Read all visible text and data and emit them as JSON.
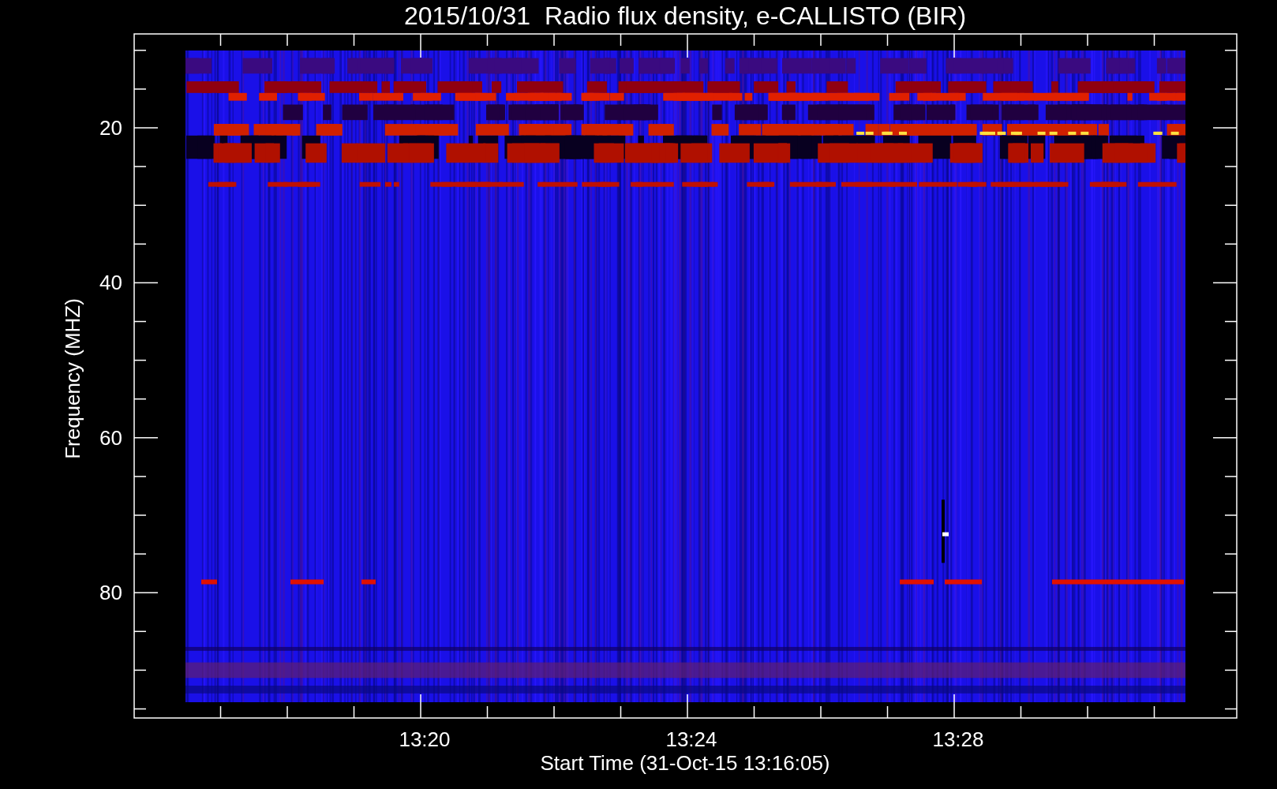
{
  "title": "2015/10/31  Radio flux density, e-CALLISTO (BIR)",
  "y_axis": {
    "label": "Frequency (MHZ)",
    "ticks": [
      "20",
      "40",
      "60",
      "80"
    ]
  },
  "x_axis": {
    "label": "Start Time (31-Oct-15 13:16:05)",
    "ticks": [
      "13:20",
      "13:24",
      "13:28"
    ]
  }
}
